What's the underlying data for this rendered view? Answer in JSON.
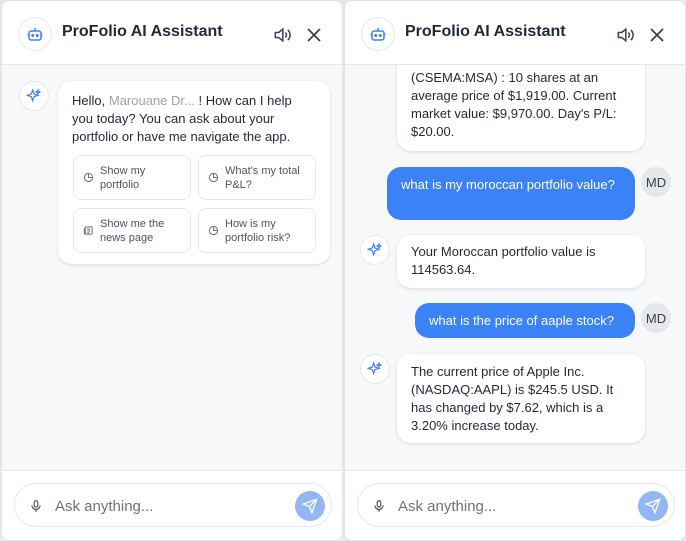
{
  "app": {
    "title": "ProFolio AI Assistant"
  },
  "left": {
    "greeting_pre": "Hello, ",
    "greeting_name": "Marouane Dr... ",
    "greeting_post": "! How can I help you today? You can ask about your portfolio or have me navigate the app.",
    "suggestions": [
      {
        "label": "Show my portfolio",
        "icon": "pie-chart-icon"
      },
      {
        "label": "What's my total P&L?",
        "icon": "pie-chart-icon"
      },
      {
        "label": "Show me the news page",
        "icon": "newspaper-icon"
      },
      {
        "label": "How is my portfolio risk?",
        "icon": "pie-chart-icon"
      }
    ],
    "input_placeholder": "Ask anything..."
  },
  "right": {
    "partial_message": "(CSEMA:MSA) : 10 shares at an average price of $1,919.00. Current market value: $9,970.00. Day's P/L: $20.00.",
    "user_initials": "MD",
    "messages": [
      {
        "role": "user",
        "text": "what is my moroccan portfolio value?"
      },
      {
        "role": "ai",
        "text": "Your Moroccan portfolio value is 114563.64."
      },
      {
        "role": "user",
        "text": "what is the price of aaple stock?"
      },
      {
        "role": "ai",
        "text": "The current price of Apple Inc. (NASDAQ:AAPL) is $245.5 USD. It has changed by $7.62, which is a 3.20% increase today."
      }
    ],
    "input_placeholder": "Ask anything..."
  },
  "colors": {
    "accent": "#3b82f6",
    "send_disabled": "#93b7f5"
  }
}
